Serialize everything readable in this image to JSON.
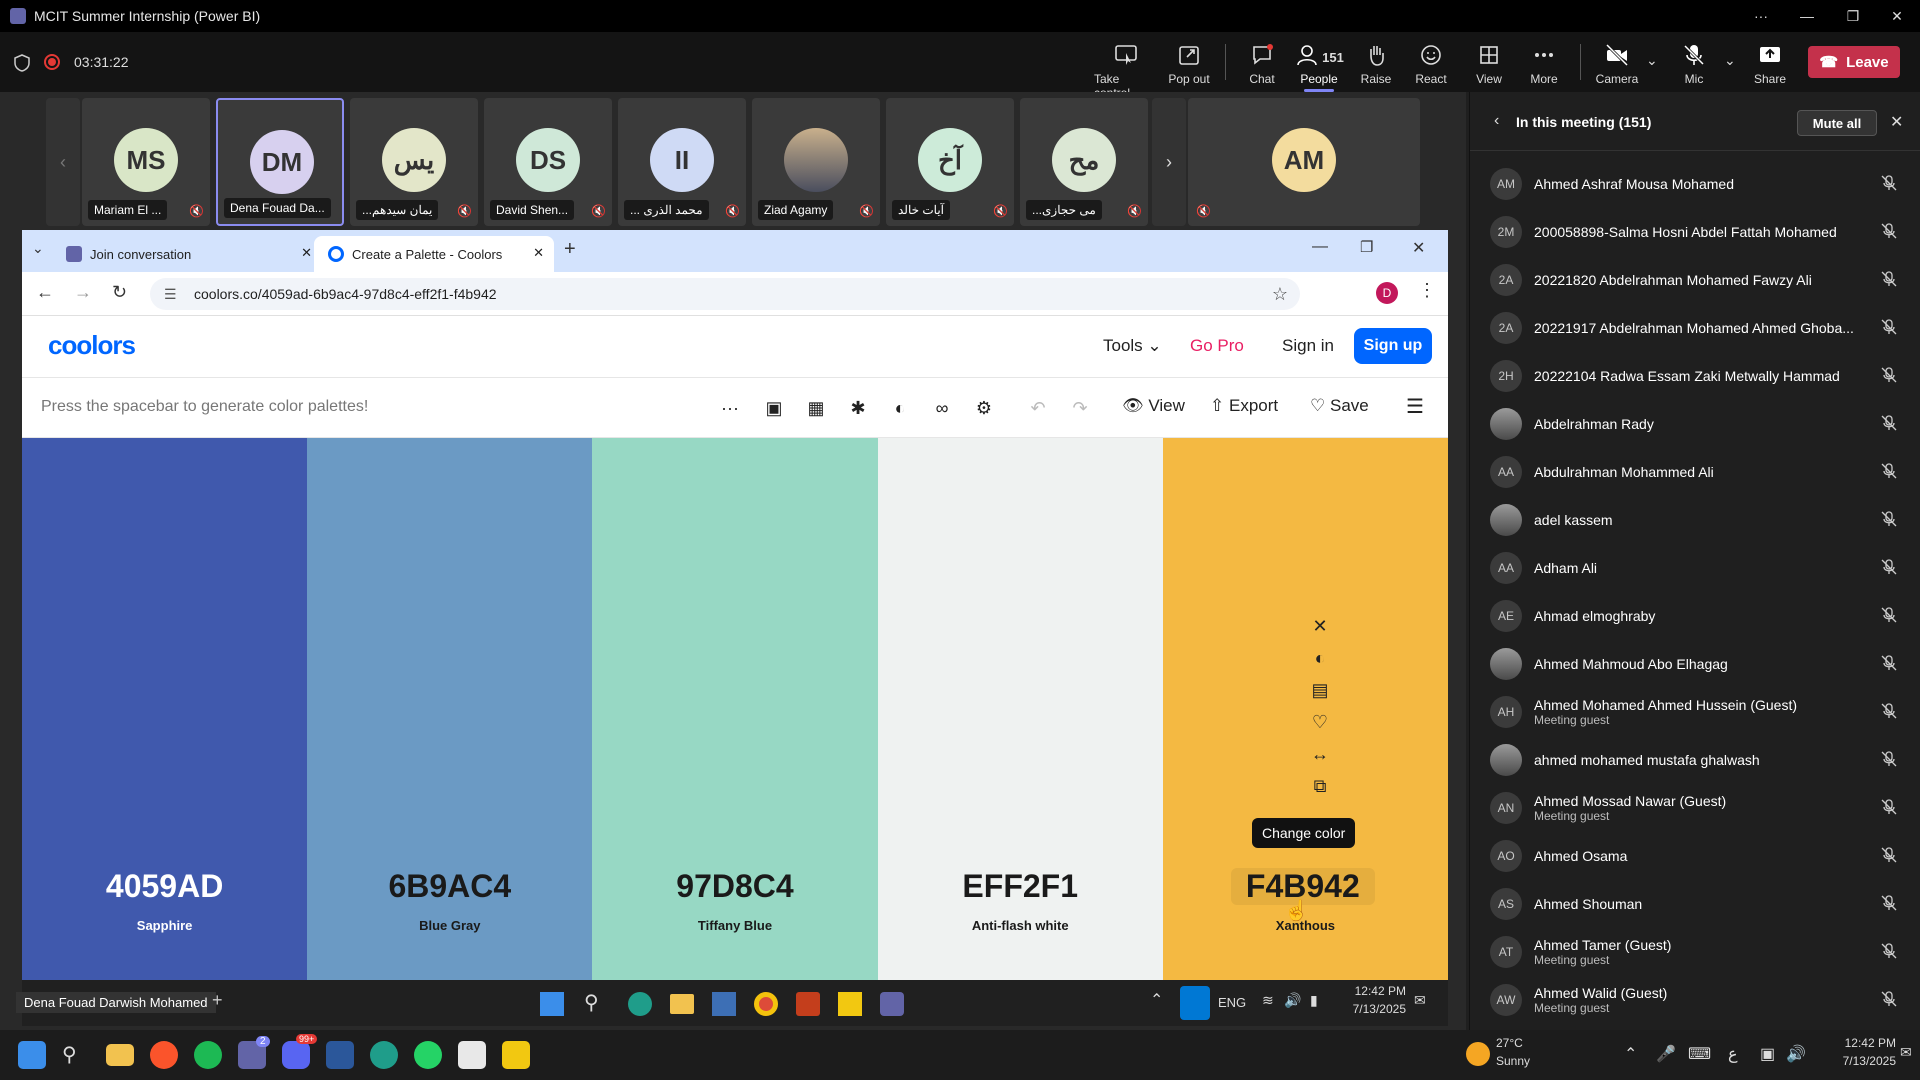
{
  "app": {
    "window_title": "MCIT Summer Internship (Power BI)",
    "recording_time": "03:31:22"
  },
  "meeting_toolbar": {
    "take_control": "Take control",
    "pop_out": "Pop out",
    "chat": "Chat",
    "people": "People",
    "people_count": "151",
    "raise": "Raise",
    "react": "React",
    "view": "View",
    "more": "More",
    "camera": "Camera",
    "mic": "Mic",
    "share": "Share",
    "leave": "Leave"
  },
  "participants_strip": [
    {
      "initials": "MS",
      "name": "Mariam El ...",
      "color": "#d9e6c7"
    },
    {
      "initials": "DM",
      "name": "Dena Fouad Da...",
      "color": "#d7d0ef"
    },
    {
      "initials": "يس",
      "name": "...يمان سيدهم",
      "color": "#e3e6c9"
    },
    {
      "initials": "DS",
      "name": "David Shen...",
      "color": "#cfe8d8"
    },
    {
      "initials": "II",
      "name": "... محمد الذرى",
      "color": "#cfdaf5"
    },
    {
      "initials": "",
      "name": "Ziad Agamy",
      "color": "#7b86a0"
    },
    {
      "initials": "آخ",
      "name": "آيات خالد",
      "color": "#cdebd9"
    },
    {
      "initials": "مح",
      "name": "...مى حجازى",
      "color": "#dbe7d4"
    },
    {
      "initials": "AM",
      "name": "",
      "color": "#f3dc9e"
    }
  ],
  "browser": {
    "tabs": [
      {
        "label": "Join conversation"
      },
      {
        "label": "Create a Palette - Coolors"
      }
    ],
    "url": "coolors.co/4059ad-6b9ac4-97d8c4-eff2f1-f4b942",
    "profile_initial": "D"
  },
  "coolors": {
    "logo": "coolors",
    "tools": "Tools",
    "go_pro": "Go Pro",
    "sign_in": "Sign in",
    "sign_up": "Sign up",
    "hint": "Press the spacebar to generate color palettes!",
    "view": "View",
    "export": "Export",
    "save": "Save",
    "tooltip": "Change color",
    "swatches": [
      {
        "hex": "4059AD",
        "name": "Sapphire",
        "color": "#4059ad",
        "text": "#ffffff"
      },
      {
        "hex": "6B9AC4",
        "name": "Blue Gray",
        "color": "#6b9ac4",
        "text": "#1a1a1a"
      },
      {
        "hex": "97D8C4",
        "name": "Tiffany Blue",
        "color": "#97d8c4",
        "text": "#1a1a1a"
      },
      {
        "hex": "EFF2F1",
        "name": "Anti-flash white",
        "color": "#eff2f1",
        "text": "#1a1a1a"
      },
      {
        "hex": "F4B942",
        "name": "Xanthous",
        "color": "#f4b942",
        "text": "#1a1a1a"
      }
    ]
  },
  "stage_bar": {
    "presenter": "Dena Fouad Darwish Mohamed",
    "inner_time": "12:42 PM",
    "inner_date": "7/13/2025",
    "lang": "ENG"
  },
  "panel": {
    "title": "In this meeting",
    "count": "(151)",
    "mute_all": "Mute all",
    "people": [
      {
        "initials": "AM",
        "name": "Ahmed Ashraf Mousa Mohamed",
        "sub": ""
      },
      {
        "initials": "2M",
        "name": "200058898-Salma Hosni Abdel Fattah Mohamed",
        "sub": ""
      },
      {
        "initials": "2A",
        "name": "20221820 Abdelrahman Mohamed Fawzy Ali",
        "sub": ""
      },
      {
        "initials": "2A",
        "name": "20221917 Abdelrahman Mohamed Ahmed Ghoba...",
        "sub": ""
      },
      {
        "initials": "2H",
        "name": "20222104 Radwa Essam Zaki Metwally Hammad",
        "sub": ""
      },
      {
        "initials": "",
        "name": "Abdelrahman Rady",
        "sub": ""
      },
      {
        "initials": "AA",
        "name": "Abdulrahman Mohammed Ali",
        "sub": ""
      },
      {
        "initials": "",
        "name": "adel kassem",
        "sub": ""
      },
      {
        "initials": "AA",
        "name": "Adham Ali",
        "sub": ""
      },
      {
        "initials": "AE",
        "name": "Ahmad elmoghraby",
        "sub": ""
      },
      {
        "initials": "",
        "name": "Ahmed Mahmoud Abo Elhagag",
        "sub": ""
      },
      {
        "initials": "AH",
        "name": "Ahmed Mohamed Ahmed Hussein (Guest)",
        "sub": "Meeting guest"
      },
      {
        "initials": "",
        "name": "ahmed mohamed mustafa ghalwash",
        "sub": ""
      },
      {
        "initials": "AN",
        "name": "Ahmed Mossad Nawar (Guest)",
        "sub": "Meeting guest"
      },
      {
        "initials": "AO",
        "name": "Ahmed Osama",
        "sub": ""
      },
      {
        "initials": "AS",
        "name": "Ahmed Shouman",
        "sub": ""
      },
      {
        "initials": "AT",
        "name": "Ahmed Tamer (Guest)",
        "sub": "Meeting guest"
      },
      {
        "initials": "AW",
        "name": "Ahmed Walid (Guest)",
        "sub": "Meeting guest"
      }
    ]
  },
  "taskbar": {
    "weather_temp": "27°C",
    "weather_desc": "Sunny",
    "time": "12:42 PM",
    "date": "7/13/2025",
    "teams_badge": "2",
    "discord_badge": "99+"
  }
}
